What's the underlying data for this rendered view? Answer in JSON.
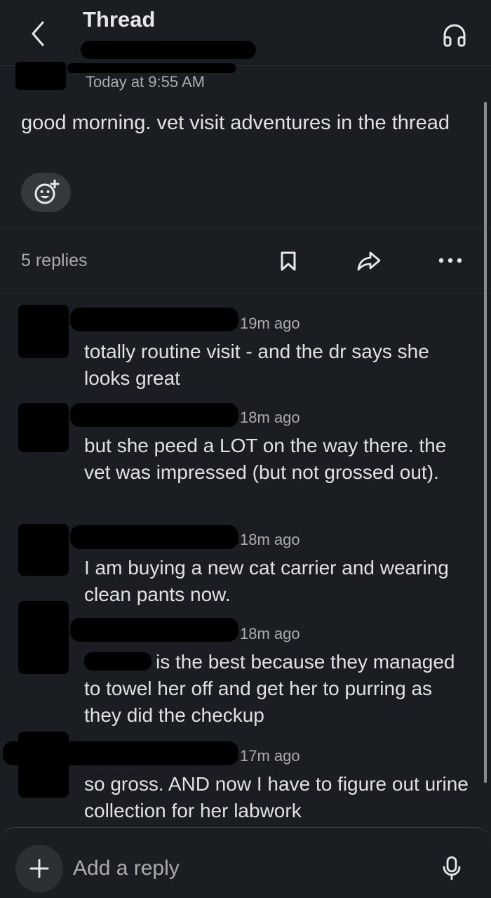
{
  "header": {
    "title": "Thread",
    "back_icon": "chevron-left-icon",
    "headphones_icon": "headphones-icon"
  },
  "parent_message": {
    "timestamp": "Today at 9:55 AM",
    "text": "good morning. vet visit adventures in the thread",
    "add_reaction_icon": "add-reaction-icon"
  },
  "thread_bar": {
    "reply_count": "5 replies",
    "bookmark_icon": "bookmark-icon",
    "share_icon": "share-icon",
    "more_icon": "more-icon"
  },
  "replies": [
    {
      "time": "19m ago",
      "text": "totally routine visit - and the dr says she looks great"
    },
    {
      "time": "18m ago",
      "text": "but she peed a LOT on the way there. the vet was impressed (but not grossed out)."
    },
    {
      "time": "18m ago",
      "text": "I am buying a new cat carrier and wearing clean pants now."
    },
    {
      "time": "18m ago",
      "text": "is the best because they managed to towel her off and get her to purring as they did the checkup"
    },
    {
      "time": "17m ago",
      "text": "so gross. AND now I have to figure out urine collection for her labwork"
    }
  ],
  "composer": {
    "placeholder": "Add a reply",
    "add_icon": "plus-icon",
    "mic_icon": "microphone-icon"
  },
  "colors": {
    "background": "#1a1d21",
    "text": "#e1e1e2",
    "muted": "#ababad",
    "divider": "#2b2e33"
  }
}
